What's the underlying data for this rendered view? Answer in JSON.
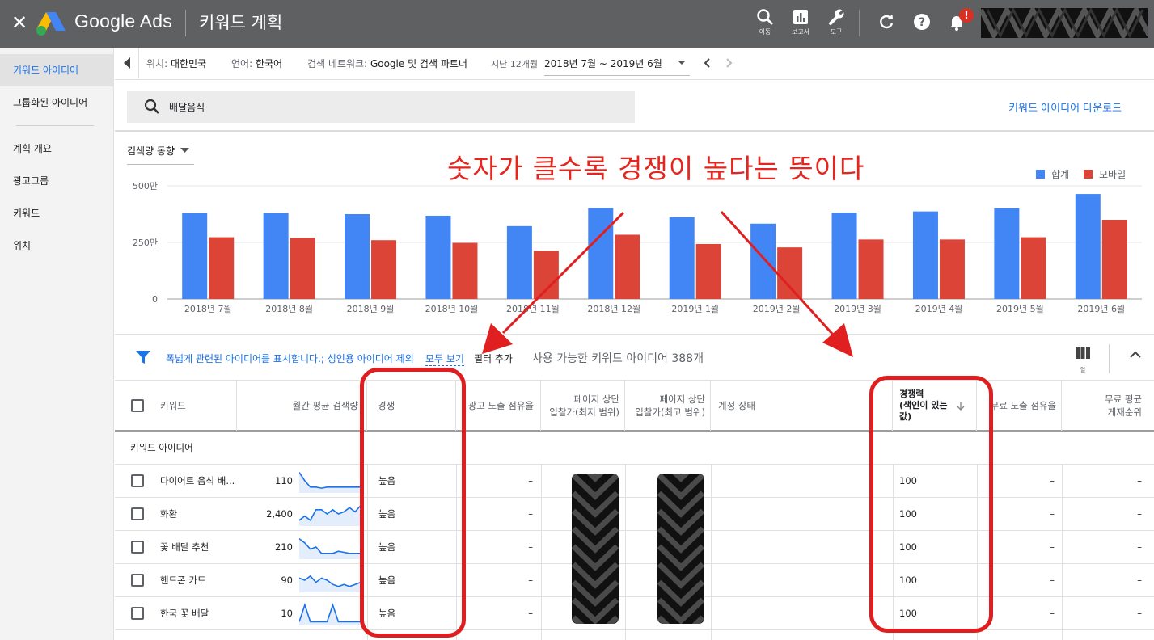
{
  "header": {
    "close_glyph": "✕",
    "brand": "Google Ads",
    "page_title": "키워드 계획",
    "icons": [
      {
        "name": "search-icon",
        "label": "이동"
      },
      {
        "name": "reports-icon",
        "label": "보고서"
      },
      {
        "name": "tools-icon",
        "label": "도구"
      }
    ],
    "notification_count": "!"
  },
  "sidebar": {
    "items": [
      {
        "label": "키워드 아이디어",
        "active": true
      },
      {
        "label": "그룹화된 아이디어"
      },
      {
        "label": "계획 개요"
      },
      {
        "label": "광고그룹"
      },
      {
        "label": "키워드"
      },
      {
        "label": "위치"
      }
    ]
  },
  "filters": {
    "location_label": "위치:",
    "location": "대한민국",
    "language_label": "언어:",
    "language": "한국어",
    "network_label": "검색 네트워크:",
    "network": "Google 및 검색 파트너",
    "period_label": "지난 12개월",
    "date_range": "2018년 7월 ~ 2019년 6월"
  },
  "search": {
    "query": "배달음식",
    "download_label": "키워드 아이디어 다운로드"
  },
  "trend": {
    "selector_label": "검색량 동향"
  },
  "annotation": {
    "text": "숫자가 클수록 경쟁이 높다는 뜻이다",
    "color": "#e5261f"
  },
  "chart_data": {
    "type": "bar",
    "categories": [
      "2018년 7월",
      "2018년 8월",
      "2018년 9월",
      "2018년 10월",
      "2018년 11월",
      "2018년 12월",
      "2019년 1월",
      "2019년 2월",
      "2019년 3월",
      "2019년 4월",
      "2019년 5월",
      "2019년 6월"
    ],
    "series": [
      {
        "name": "합계",
        "color": "#4285f4",
        "values": [
          3800000,
          3800000,
          3750000,
          3680000,
          3220000,
          4020000,
          3620000,
          3330000,
          3820000,
          3870000,
          4010000,
          4640000
        ]
      },
      {
        "name": "모바일",
        "color": "#db4437",
        "values": [
          2730000,
          2700000,
          2600000,
          2480000,
          2130000,
          2840000,
          2430000,
          2280000,
          2630000,
          2630000,
          2730000,
          3500000
        ]
      }
    ],
    "y_ticks": [
      "0",
      "250만",
      "500만"
    ],
    "ylim": [
      0,
      5000000
    ],
    "legend_position": "top-right",
    "grid": true
  },
  "keyword_toolbar": {
    "filter_text": "폭넓게 관련된 아이디어를 표시합니다.; 성인용 아이디어 제외",
    "show_all": "모두 보기",
    "add_filter": "필터 추가",
    "count_text": "사용 가능한 키워드 아이디어 388개",
    "columns_label": "열"
  },
  "table": {
    "headers": {
      "keyword": "키워드",
      "monthly": "월간 평균 검색량",
      "competition": "경쟁",
      "impression_share": "광고 노출 점유율",
      "bid_low": "페이지 상단\n입찰가(최저 범위)",
      "bid_high": "페이지 상단\n입찰가(최고 범위)",
      "account_status": "계정 상태",
      "competition_index": "경쟁력\n(색인이 있는\n값)",
      "organic_share": "무료 노출 점유율",
      "organic_rank": "무료 평균\n게재순위"
    },
    "group_label": "키워드 아이디어",
    "rows": [
      {
        "keyword": "다이어트 음식 배...",
        "volume": "110",
        "competition": "높음",
        "impression": "–",
        "index": "100",
        "organic_share": "–",
        "organic_rank": "–",
        "trend": [
          9,
          5,
          2,
          2,
          1.5,
          2,
          2,
          2,
          2,
          2,
          2,
          2
        ]
      },
      {
        "keyword": "화환",
        "volume": "2,400",
        "competition": "높음",
        "impression": "–",
        "index": "100",
        "organic_share": "–",
        "organic_rank": "–",
        "trend": [
          2,
          4,
          2,
          7,
          7,
          5,
          7,
          5,
          6,
          8,
          6,
          9
        ]
      },
      {
        "keyword": "꽃 배달 추천",
        "volume": "210",
        "competition": "높음",
        "impression": "–",
        "index": "100",
        "organic_share": "–",
        "organic_rank": "–",
        "trend": [
          9,
          7,
          4,
          5,
          2,
          2,
          2,
          3,
          2.5,
          2,
          2,
          2
        ]
      },
      {
        "keyword": "핸드폰 카드",
        "volume": "90",
        "competition": "높음",
        "impression": "–",
        "index": "100",
        "organic_share": "–",
        "organic_rank": "–",
        "trend": [
          6,
          5,
          7,
          4,
          6,
          5,
          3,
          2,
          3,
          2,
          3,
          4
        ]
      },
      {
        "keyword": "한국 꽃 배달",
        "volume": "10",
        "competition": "높음",
        "impression": "–",
        "index": "100",
        "organic_share": "–",
        "organic_rank": "–",
        "trend": [
          1,
          9,
          1,
          1,
          1,
          1,
          9,
          1,
          1,
          1,
          1,
          1
        ]
      }
    ]
  }
}
